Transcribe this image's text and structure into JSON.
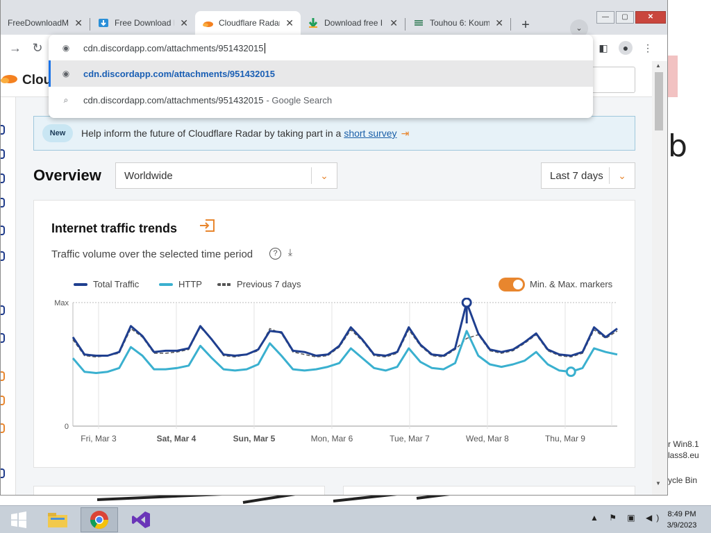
{
  "tabs": [
    {
      "label": "FreeDownloadM",
      "active": false
    },
    {
      "label": "Free Download I",
      "active": false
    },
    {
      "label": "Cloudflare Radar",
      "active": true
    },
    {
      "label": "Download free I",
      "active": false
    },
    {
      "label": "Touhou 6: Koum",
      "active": false
    }
  ],
  "omnibox": {
    "input_value": "cdn.discordapp.com/attachments/951432015",
    "suggestions": [
      {
        "text": "cdn.discordapp.com/attachments/951432015",
        "sub": ""
      },
      {
        "text": "cdn.discordapp.com/attachments/951432015",
        "sub": "- Google Search"
      }
    ]
  },
  "page": {
    "logo_text": "Clou",
    "banner": {
      "badge": "New",
      "text": "Help inform the future of Cloudflare Radar by taking part in a",
      "link": "short survey"
    },
    "overview_title": "Overview",
    "location_select": "Worldwide",
    "range_select": "Last 7 days",
    "card": {
      "title": "Internet traffic trends",
      "subtitle": "Traffic volume over the selected time period",
      "legend": {
        "total": "Total Traffic",
        "http": "HTTP",
        "previous": "Previous 7 days",
        "minmax": "Min. & Max. markers"
      }
    }
  },
  "colors": {
    "total": "#1f3f8f",
    "http": "#3ab0cf",
    "accent": "#e8862e"
  },
  "chart_data": {
    "type": "line",
    "y_tick_labels": [
      "0",
      "Max"
    ],
    "x_tick_labels": [
      "Fri, Mar 3",
      "Sat, Mar 4",
      "Sun, Mar 5",
      "Mon, Mar 6",
      "Tue, Mar 7",
      "Wed, Mar 8",
      "Thu, Mar 9"
    ],
    "ylim": [
      0,
      100
    ],
    "legend_position": "top",
    "series": [
      {
        "name": "Total Traffic",
        "color": "#1f3f8f",
        "values": [
          72,
          58,
          57,
          57,
          60,
          81,
          73,
          60,
          61,
          61,
          63,
          81,
          70,
          58,
          57,
          58,
          62,
          77,
          76,
          61,
          60,
          57,
          58,
          65,
          80,
          70,
          58,
          57,
          60,
          80,
          66,
          58,
          57,
          63,
          100,
          75,
          62,
          60,
          62,
          68,
          75,
          62,
          58,
          57,
          60,
          80,
          72,
          79
        ]
      },
      {
        "name": "HTTP",
        "color": "#3ab0cf",
        "values": [
          55,
          44,
          43,
          44,
          47,
          64,
          57,
          46,
          46,
          47,
          49,
          65,
          55,
          46,
          45,
          46,
          50,
          67,
          57,
          46,
          45,
          46,
          48,
          51,
          63,
          55,
          47,
          45,
          48,
          63,
          52,
          47,
          46,
          51,
          77,
          57,
          50,
          48,
          50,
          53,
          60,
          50,
          45,
          44,
          47,
          63,
          60,
          58
        ]
      },
      {
        "name": "Previous 7 days",
        "color": "#555555",
        "dashed": true,
        "values": [
          70,
          57,
          56,
          57,
          59,
          79,
          72,
          59,
          59,
          60,
          62,
          80,
          70,
          57,
          56,
          58,
          61,
          79,
          75,
          60,
          58,
          56,
          57,
          64,
          78,
          69,
          57,
          56,
          59,
          78,
          65,
          57,
          56,
          62,
          71,
          74,
          61,
          59,
          61,
          67,
          74,
          61,
          57,
          56,
          59,
          78,
          71,
          77
        ]
      }
    ]
  },
  "taskbar": {
    "clock_time": "8:49 PM",
    "clock_date": "3/9/2023"
  },
  "desktop": {
    "icon_label_1": "r Win8.1",
    "icon_label_2": "lass8.eu",
    "icon_label_3": "ycle Bin"
  }
}
